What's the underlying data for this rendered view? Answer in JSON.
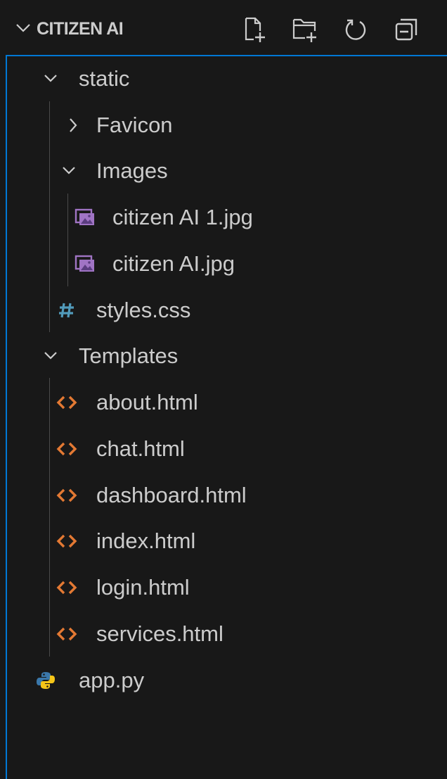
{
  "explorer": {
    "title": "CITIZEN AI",
    "toolbar": {
      "icons": [
        "new-file-icon",
        "new-folder-icon",
        "refresh-icon",
        "collapse-all-icon"
      ]
    },
    "tree": [
      {
        "label": "static",
        "type": "folder",
        "expanded": true
      },
      {
        "label": "Favicon",
        "type": "folder",
        "expanded": false
      },
      {
        "label": "Images",
        "type": "folder",
        "expanded": true
      },
      {
        "label": "citizen AI 1.jpg",
        "type": "image"
      },
      {
        "label": "citizen AI.jpg",
        "type": "image"
      },
      {
        "label": "styles.css",
        "type": "css"
      },
      {
        "label": "Templates",
        "type": "folder",
        "expanded": true
      },
      {
        "label": "about.html",
        "type": "html"
      },
      {
        "label": "chat.html",
        "type": "html"
      },
      {
        "label": "dashboard.html",
        "type": "html"
      },
      {
        "label": "index.html",
        "type": "html"
      },
      {
        "label": "login.html",
        "type": "html"
      },
      {
        "label": "services.html",
        "type": "html"
      },
      {
        "label": "app.py",
        "type": "python"
      }
    ]
  },
  "colors": {
    "background": "#181818",
    "text": "#cccccc",
    "focus_border": "#0078d4",
    "image_icon": "#a074c4",
    "css_icon": "#519aba",
    "html_icon": "#e37933",
    "python_icon_blue": "#3b78aa",
    "python_icon_yellow": "#f5c518"
  }
}
